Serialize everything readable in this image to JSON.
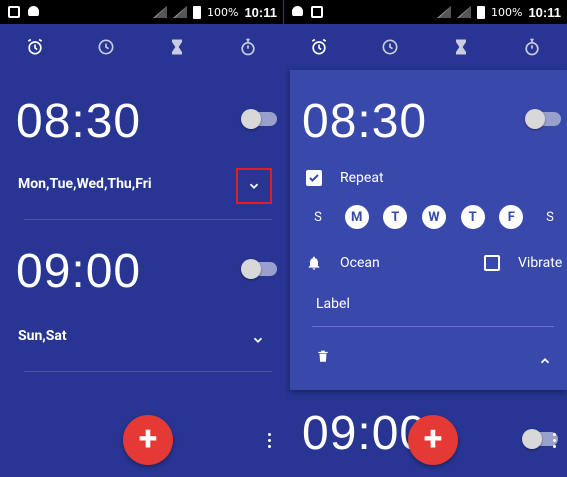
{
  "status_bar": {
    "left": {
      "battery_percent": "100%",
      "time": "10:11"
    },
    "right": {
      "battery_percent": "100%",
      "time": "10:11"
    }
  },
  "tabs": [
    {
      "name": "alarm",
      "icon": "alarm-clock-icon"
    },
    {
      "name": "clock",
      "icon": "clock-icon"
    },
    {
      "name": "timer",
      "icon": "hourglass-icon"
    },
    {
      "name": "stopwatch",
      "icon": "stopwatch-icon"
    }
  ],
  "left_panel": {
    "alarms": [
      {
        "time": "08:30",
        "days": "Mon,Tue,Wed,Thu,Fri",
        "enabled": false
      },
      {
        "time": "09:00",
        "days": "Sun,Sat",
        "enabled": false
      }
    ]
  },
  "right_panel": {
    "alarm_expanded": {
      "time": "08:30",
      "repeat_label": "Repeat",
      "repeat_checked": true,
      "days": [
        {
          "letter": "S",
          "selected": false
        },
        {
          "letter": "M",
          "selected": true
        },
        {
          "letter": "T",
          "selected": true
        },
        {
          "letter": "W",
          "selected": true
        },
        {
          "letter": "T",
          "selected": true
        },
        {
          "letter": "F",
          "selected": true
        },
        {
          "letter": "S",
          "selected": false
        }
      ],
      "ringtone": "Ocean",
      "vibrate_label": "Vibrate",
      "vibrate_checked": false,
      "label_placeholder": "Label"
    },
    "next_alarm_time": "09:00"
  },
  "colors": {
    "background": "#283593",
    "card": "#3949ab",
    "fab": "#e53935",
    "highlight_box": "#e02020"
  }
}
